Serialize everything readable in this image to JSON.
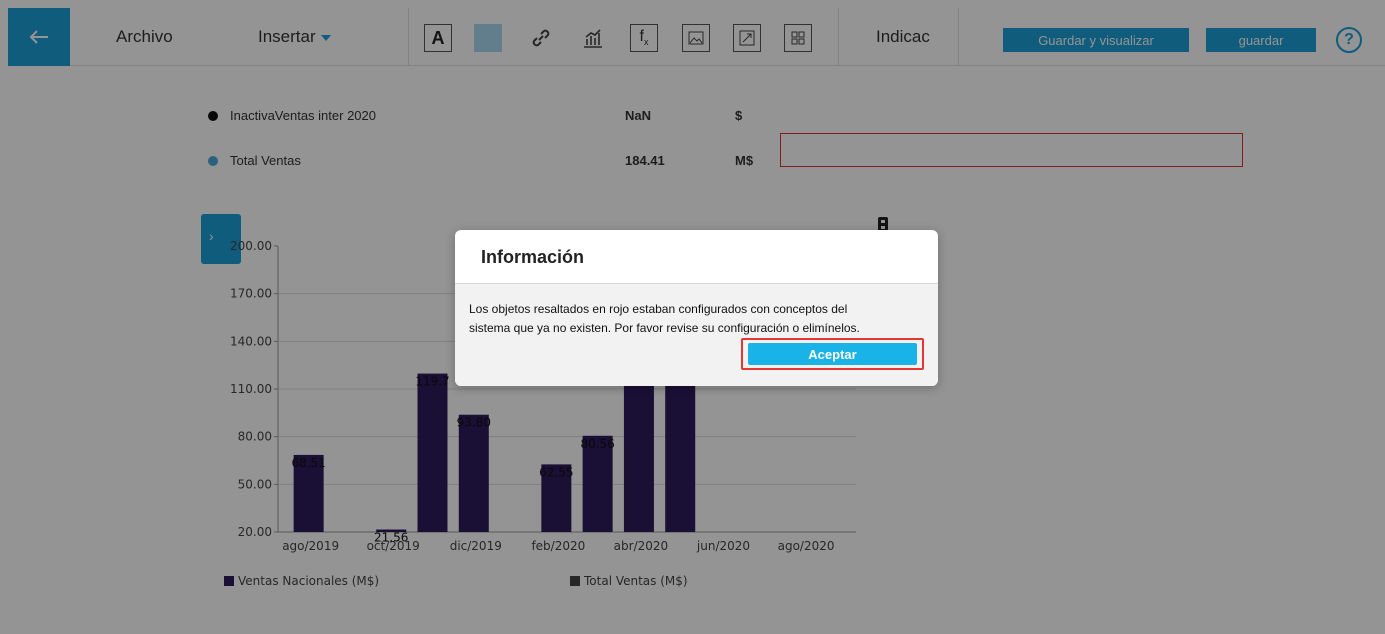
{
  "toolbar": {
    "archivo": "Archivo",
    "insertar": "Insertar",
    "indicador": "Indicac",
    "guardar_visualizar": "Guardar y visualizar",
    "guardar": "guardar",
    "help": "?",
    "tools": [
      "text-tool-icon",
      "color-tool-icon",
      "link-tool-icon",
      "chart-tool-icon",
      "formula-tool-icon",
      "image-tool-icon",
      "expand-tool-icon",
      "grid-tool-icon"
    ]
  },
  "summary": [
    {
      "label": "InactivaVentas inter 2020",
      "value": "NaN",
      "unit": "$",
      "color": "#111111"
    },
    {
      "label": "Total Ventas",
      "value": "184.41",
      "unit": "M$",
      "color": "#4aa8d8"
    }
  ],
  "chart_data": {
    "type": "bar",
    "y_ticks": [
      "200.00",
      "170.00",
      "140.00",
      "110.00",
      "80.00",
      "50.00",
      "20.00"
    ],
    "ylim": [
      20,
      200
    ],
    "x_ticks": [
      "ago/2019",
      "oct/2019",
      "dic/2019",
      "feb/2020",
      "abr/2020",
      "jun/2020",
      "ago/2020"
    ],
    "series": [
      {
        "name": "Ventas Nacionales (M$)",
        "color": "#2e1a5c",
        "bars": [
          {
            "slot": 0,
            "value": 68.51,
            "label": "68.51"
          },
          {
            "slot": 2,
            "value": 21.56,
            "label": "21.56"
          },
          {
            "slot": 3,
            "value": 119.7,
            "label": "119.7"
          },
          {
            "slot": 4,
            "value": 93.8,
            "label": "93.80"
          },
          {
            "slot": 6,
            "value": 62.55,
            "label": "62.55"
          },
          {
            "slot": 7,
            "value": 80.56,
            "label": "80.56"
          },
          {
            "slot": 8,
            "value": 129.0,
            "label": ""
          },
          {
            "slot": 9,
            "value": 170.0,
            "label": ""
          }
        ]
      },
      {
        "name": "Total Ventas (M$)",
        "color": "#444444",
        "bars": []
      }
    ]
  },
  "modal": {
    "title": "Información",
    "line1": "Los objetos resaltados en rojo estaban configurados con conceptos del",
    "line2": "sistema que ya no existen. Por favor revise su configuración o elimínelos.",
    "accept": "Aceptar"
  }
}
